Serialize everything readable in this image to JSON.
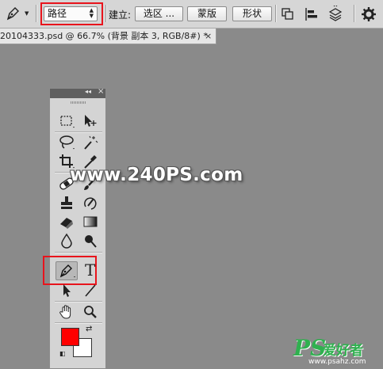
{
  "options_bar": {
    "mode_select_value": "路径",
    "make_label": "建立:",
    "selection_button": "选区 ...",
    "mask_button": "蒙版",
    "shape_button": "形状",
    "icons": [
      "pen-tool-icon",
      "path-operations-icon",
      "path-alignment-icon",
      "path-arrangement-icon",
      "settings-gear-icon"
    ]
  },
  "document_tab": {
    "title": "20104333.psd @ 66.7% (背景 副本 3, RGB/8#) *",
    "close_label": "×"
  },
  "tools_panel": {
    "collapse_label": "◂◂",
    "close_label": "×",
    "tools": [
      "rectangular-marquee-icon",
      "move-tool-icon",
      "lasso-tool-icon",
      "magic-wand-icon",
      "crop-tool-icon",
      "eyedropper-icon",
      "healing-brush-icon",
      "brush-tool-icon",
      "clone-stamp-icon",
      "history-brush-icon",
      "eraser-tool-icon",
      "gradient-tool-icon",
      "blur-tool-icon",
      "dodge-tool-icon",
      "pen-tool-icon",
      "type-tool-icon",
      "path-selection-icon",
      "line-tool-icon",
      "hand-tool-icon",
      "zoom-tool-icon"
    ],
    "type_tool_glyph": "T",
    "selected_tool": "pen-tool-icon",
    "foreground_color": "#ff0000",
    "background_color": "#ffffff"
  },
  "watermark": {
    "site": "www.240PS.com",
    "logo_ps": "PS",
    "logo_cn": "爱好者",
    "logo_url": "www.psahz.com"
  },
  "colors": {
    "highlight_red": "#e8141c",
    "canvas_gray": "#8a8a8a",
    "logo_green": "#2fb14f"
  }
}
